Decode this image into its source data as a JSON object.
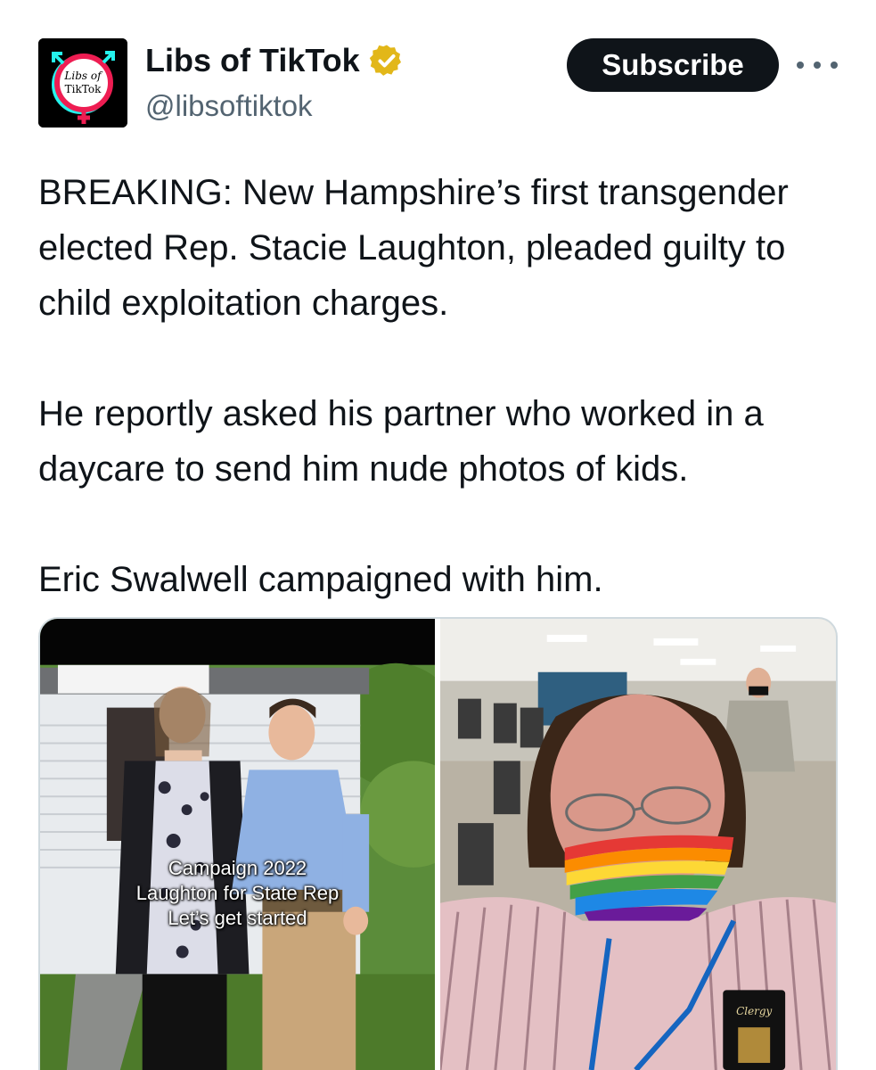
{
  "post": {
    "author": {
      "display_name": "Libs of TikTok",
      "handle": "@libsoftiktok",
      "verified": true,
      "verified_badge_color": "#e2b719",
      "avatar_text": "Libs of TikTok",
      "avatar_colors": {
        "background": "#000000",
        "ring_pink": "#ee1d52",
        "ring_cyan": "#25f4ee"
      }
    },
    "subscribe_label": "Subscribe",
    "more_icon": "more-options-icon",
    "text": {
      "paragraph_1": "BREAKING: New Hampshire’s first transgender elected Rep. Stacie Laughton, pleaded guilty to child exploitation charges.",
      "paragraph_2": "He reportly asked his partner who worked in a daycare to send him nude photos of kids.",
      "paragraph_3": "Eric Swalwell campaigned with him."
    },
    "media": [
      {
        "kind": "photo",
        "caption_lines": [
          "Campaign 2022",
          "Laughton for State Rep",
          "Let’s get started"
        ]
      },
      {
        "kind": "photo",
        "badge_text": "Clergy"
      }
    ]
  },
  "colors": {
    "text_primary": "#0f1419",
    "text_secondary": "#536471",
    "button_bg": "#0f1419",
    "button_text": "#ffffff",
    "media_border": "#cfd9de"
  }
}
